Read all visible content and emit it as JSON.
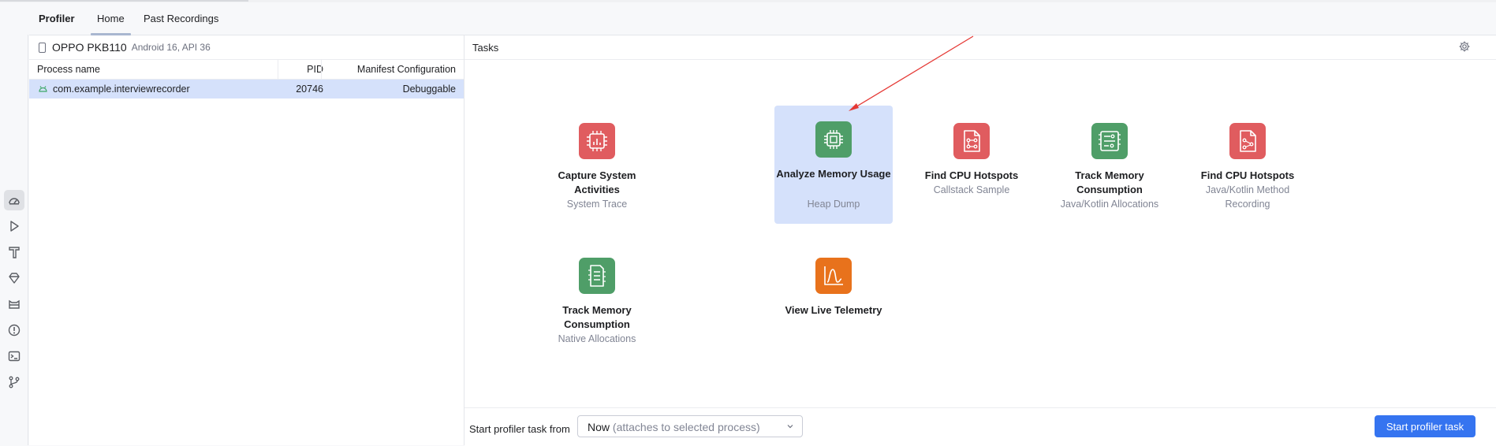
{
  "tabs": {
    "title": "Profiler",
    "home": "Home",
    "past": "Past Recordings"
  },
  "device": {
    "name": "OPPO PKB110",
    "detail": "Android 16, API 36"
  },
  "process_table": {
    "headers": [
      "Process name",
      "PID",
      "Manifest Configuration"
    ],
    "rows": [
      [
        "com.example.interviewrecorder",
        "20746",
        "Debuggable"
      ]
    ]
  },
  "tasks_panel": {
    "title": "Tasks",
    "items": [
      {
        "name": "Capture System Activities",
        "sub": "System Trace",
        "color": "#e05c5f",
        "icon": "cpu-chart-icon"
      },
      {
        "name": "Analyze Memory Usage",
        "sub": "Heap Dump",
        "color": "#4f9e68",
        "icon": "memory-chip-icon",
        "selected": true
      },
      {
        "name": "Find CPU Hotspots",
        "sub": "Callstack Sample",
        "color": "#e05c5f",
        "icon": "callstack-doc-icon"
      },
      {
        "name": "Track Memory Consumption",
        "sub": "Java/Kotlin Allocations",
        "color": "#4f9e68",
        "icon": "memory-board-icon"
      },
      {
        "name": "Find CPU Hotspots",
        "sub": "Java/Kotlin Method Recording",
        "color": "#e05c5f",
        "icon": "method-doc-icon"
      },
      {
        "name": "Track Memory Consumption",
        "sub": "Native Allocations",
        "color": "#4f9e68",
        "icon": "native-memory-icon"
      },
      {
        "name": "View Live Telemetry",
        "sub": "",
        "color": "#e8721c",
        "icon": "telemetry-chart-icon"
      }
    ]
  },
  "footer": {
    "label": "Start profiler task from",
    "select_value": "Now",
    "select_hint": "(attaches to selected process)",
    "start_button": "Start profiler task"
  },
  "colors": {
    "accent": "#3574f0",
    "selection": "#d5e1fb",
    "annotation_arrow": "#e53935"
  }
}
